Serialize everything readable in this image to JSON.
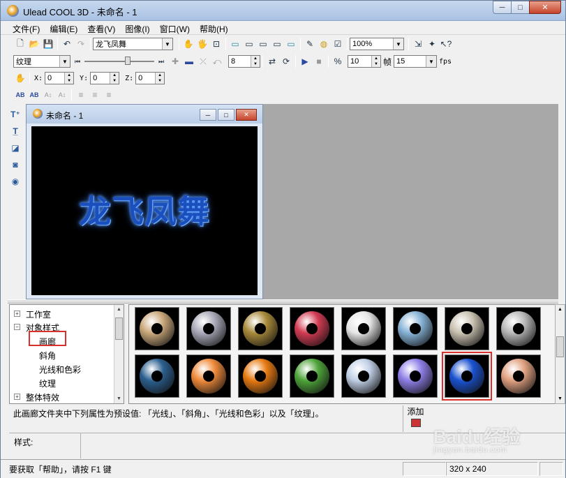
{
  "window": {
    "title": "Ulead COOL 3D - 未命名 - 1",
    "min": "─",
    "max": "□",
    "close": "✕"
  },
  "menu": [
    "文件(F)",
    "编辑(E)",
    "查看(V)",
    "图像(I)",
    "窗口(W)",
    "帮助(H)"
  ],
  "toolbar1": {
    "text_combo": "龙飞凤舞",
    "zoom": "100%"
  },
  "toolbar2": {
    "attr_combo": "纹理",
    "value1": "8",
    "frame": "10",
    "frame_label": "帧",
    "fps_value": "15",
    "fps_label": "fps"
  },
  "toolbar3": {
    "x_label": "X:",
    "x": "0",
    "y_label": "Y:",
    "y": "0",
    "z_label": "Z:",
    "z": "0"
  },
  "toolbar4": {
    "buttons": [
      "AB",
      "AB",
      "A↕",
      "A↕"
    ]
  },
  "doc": {
    "title": "未命名 - 1",
    "text": "龙飞凤舞"
  },
  "tree": {
    "items": [
      {
        "label": "工作室",
        "exp": "+"
      },
      {
        "label": "对象样式",
        "exp": "−"
      },
      {
        "label": "画廊"
      },
      {
        "label": "斜角"
      },
      {
        "label": "光线和色彩"
      },
      {
        "label": "纹理"
      },
      {
        "label": "整体特效",
        "exp": "+"
      }
    ]
  },
  "gallery": {
    "presets": [
      {
        "color": "#c9a77a"
      },
      {
        "color": "#a8a8b8"
      },
      {
        "color": "#a88a3a"
      },
      {
        "color": "#d23b52"
      },
      {
        "color": "#e6e6e6"
      },
      {
        "color": "#86b2d6"
      },
      {
        "color": "#c8c0b0"
      },
      {
        "color": "#b8b8b8"
      },
      {
        "color": "#2b5f8e"
      },
      {
        "color": "#f08a3a"
      },
      {
        "color": "#e77a12"
      },
      {
        "color": "#4ea43a"
      },
      {
        "color": "#c0cfe6"
      },
      {
        "color": "#8d7ee6"
      },
      {
        "color": "#1a52cf"
      },
      {
        "color": "#e0a080"
      }
    ],
    "selected_index": 14
  },
  "description": "此画廊文件夹中下列属性为预设值: 「光线」、「斜角」、「光线和色彩」以及「纹理」。",
  "add_label": "添加",
  "style_label": "样式:",
  "status": {
    "message": "要获取「帮助」，请按 F1 键",
    "size": "320 x 240"
  },
  "watermark": {
    "brand": "Baidu经验",
    "sub": "jingyan.baidu.com"
  }
}
